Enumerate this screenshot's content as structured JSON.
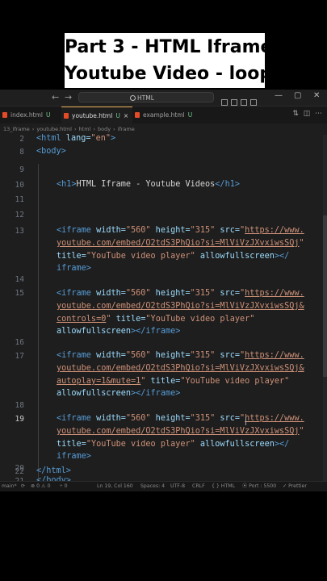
{
  "caption": {
    "line1": "Part 3 - HTML Iframe",
    "line2": "Youtube Video - loop"
  },
  "titlebar": {
    "back": "←",
    "forward": "→",
    "search_text": "HTML",
    "window_controls": [
      "—",
      "▢",
      "✕"
    ]
  },
  "tabs": [
    {
      "label": "index.html",
      "modified": "U",
      "active": false
    },
    {
      "label": "youtube.html",
      "modified": "U",
      "active": true,
      "close": "×"
    },
    {
      "label": "example.html",
      "modified": "U",
      "active": false
    }
  ],
  "breadcrumb": [
    "13_Iframe",
    "youtube.html",
    "html",
    "body",
    "iframe"
  ],
  "lines": {
    "l2": "2",
    "l8": "8",
    "l9": "9",
    "l10": "10",
    "l11": "11",
    "l12": "12",
    "l13": "13",
    "l14": "14",
    "l15": "15",
    "l16": "16",
    "l17": "17",
    "l18": "18",
    "l19": "19",
    "l20": "20",
    "l21": "21",
    "l22": "22"
  },
  "code": {
    "html_open": "<html",
    "lang_attr": " lang=",
    "lang_val": "\"en\"",
    "html_close_bracket": ">",
    "body_open": "<body>",
    "h1_open": "<h1>",
    "h1_text": "HTML Iframe - Youtube Videos",
    "h1_close": "</h1>",
    "iframe_open": "<iframe",
    "width_attr": " width=",
    "width_val": "\"560\"",
    "height_attr": " height=",
    "height_val": "\"315\"",
    "src_attr": " src=",
    "src_q": "\"",
    "url_part1": "https://www.",
    "url_part2": "youtube.com/embed/O2tdS3PhQio?si=MlViVzJXvxiwsSQj",
    "url_part2_amp": "youtube.com/embed/O2tdS3PhQio?si=MlViVzJXvxiwsSQj&",
    "controls": "controls=0",
    "autoplay": "autoplay=1&mute=1",
    "title_attr": "title=",
    "title_attr_sp": " title=",
    "title_val": "\"YouTube video player\"",
    "allowfs": " allowfullscreen",
    "allowfs_nosp": "allowfullscreen",
    "close_slash": "></",
    "close_full": "></iframe>",
    "iframe_word": "iframe>",
    "body_close": "</body>",
    "html_close": "</html>"
  },
  "statusbar": {
    "branch": "main*",
    "sync": "⟳",
    "problems": "⊗ 0 ⚠ 0",
    "ports": "⑂ 0",
    "position": "Ln 19, Col 160",
    "spaces": "Spaces: 4",
    "encoding": "UTF-8",
    "eol": "CRLF",
    "language": "{ } HTML",
    "port": "⦿ Port : 5500",
    "formatter": "✓ Prettier"
  }
}
